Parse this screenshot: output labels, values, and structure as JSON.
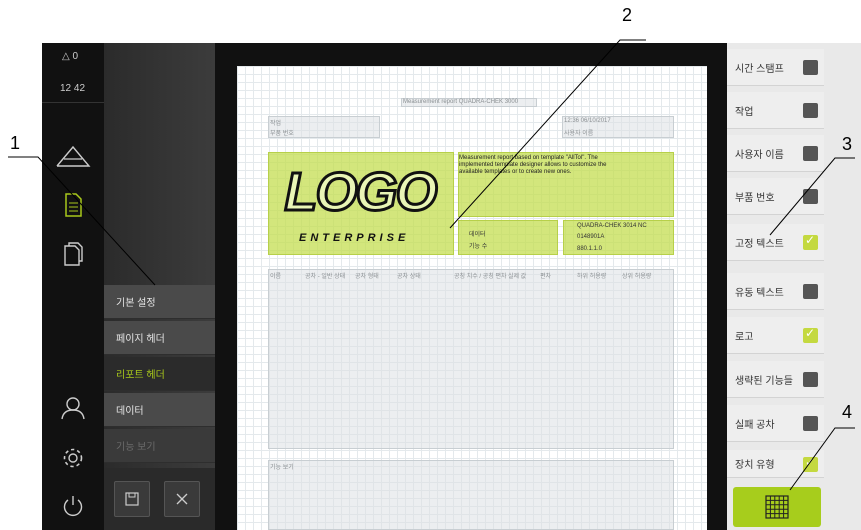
{
  "status": {
    "alerts": "0",
    "time": "12 42"
  },
  "menu": {
    "items": [
      "기본 설정",
      "페이지 헤더",
      "리포트 헤더",
      "데이터",
      "기능 보기"
    ],
    "active": "리포트 헤더"
  },
  "report": {
    "title": "Measurement report QUADRA-CHEK 3000",
    "job_label": "작업",
    "part_label": "부품 번호",
    "datetime": "12:36 06/10/2017",
    "user_label": "사용자 이름",
    "info_text": "Measurement report based on template \"AllTol\". The implemented template designer allows to customize the available templates or to create new ones.",
    "logo_main": "LOGO",
    "logo_sub": "ENTERPRISE",
    "field_data_label": "데이터",
    "field_count_label": "기능 수",
    "device_name": "QUADRA-CHEK 3014 NC",
    "device_id": "0148901A",
    "version": "880.1.1.0",
    "table_headers": [
      "이름",
      "공차 - 일반 상태",
      "공차 형태",
      "공차 상태",
      "공칭 치수 / 공칭 편차",
      "실제 값",
      "편차",
      "하위 허용량",
      "상위 허용량"
    ],
    "feature_view_label": "기능 보기"
  },
  "options": [
    {
      "label": "시간 스탬프",
      "checked": false
    },
    {
      "label": "작업",
      "checked": false
    },
    {
      "label": "사용자 이름",
      "checked": false
    },
    {
      "label": "부품 번호",
      "checked": false
    },
    {
      "label": "고정 텍스트",
      "checked": true
    },
    {
      "label": "유동 텍스트",
      "checked": false
    },
    {
      "label": "로고",
      "checked": true
    },
    {
      "label": "생략된 기능들",
      "checked": false
    },
    {
      "label": "실패 공차",
      "checked": false
    },
    {
      "label": "장치 유형",
      "checked": true
    }
  ],
  "callouts": [
    "1",
    "2",
    "3",
    "4"
  ],
  "colors": {
    "accent": "#a8c81b",
    "sidebar": "#111111",
    "checked": "#c4d940"
  }
}
